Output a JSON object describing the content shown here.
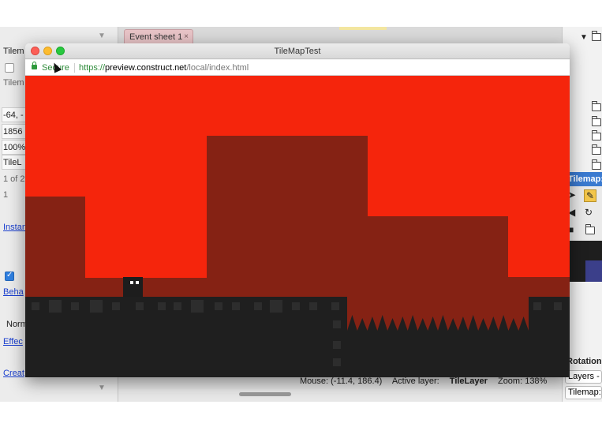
{
  "editor": {
    "event_tab": "Event sheet 1",
    "left_panel": {
      "rows_top": [
        "Tilem",
        "Tilem",
        "-64, -",
        "1856",
        "100%",
        "TileL",
        "1 of 2",
        "1"
      ],
      "instance_link": "Instan",
      "behaviors_link": "Beha",
      "normal_text": "Norm",
      "effects_link": "Effec",
      "create_link": "Creat"
    },
    "right_panel": {
      "object_title": "Tilemap: T",
      "rotation_label": "Rotation",
      "layers_label": "Layers -",
      "tilemap_box": "Tilemap:"
    },
    "status": {
      "mouse": "Mouse: (-11.4, 186.4)",
      "active_layer_label": "Active layer:",
      "active_layer_value": "TileLayer",
      "zoom": "Zoom: 138%"
    }
  },
  "preview": {
    "window_title": "TileMapTest",
    "secure_label": "Secure",
    "url_scheme": "https://",
    "url_host": "preview.construct.net",
    "url_path": "/local/index.html"
  },
  "colors": {
    "sky": "#f5250c",
    "hill": "#852214",
    "ground": "#1f1f1f",
    "accent_blue": "#3a7ad0"
  },
  "icons": [
    "lock-icon",
    "folder-icon",
    "arrow-tool-icon",
    "pencil-tool-icon",
    "eraser-tool-icon",
    "rotate-icon",
    "save-icon",
    "cursor-icon"
  ]
}
